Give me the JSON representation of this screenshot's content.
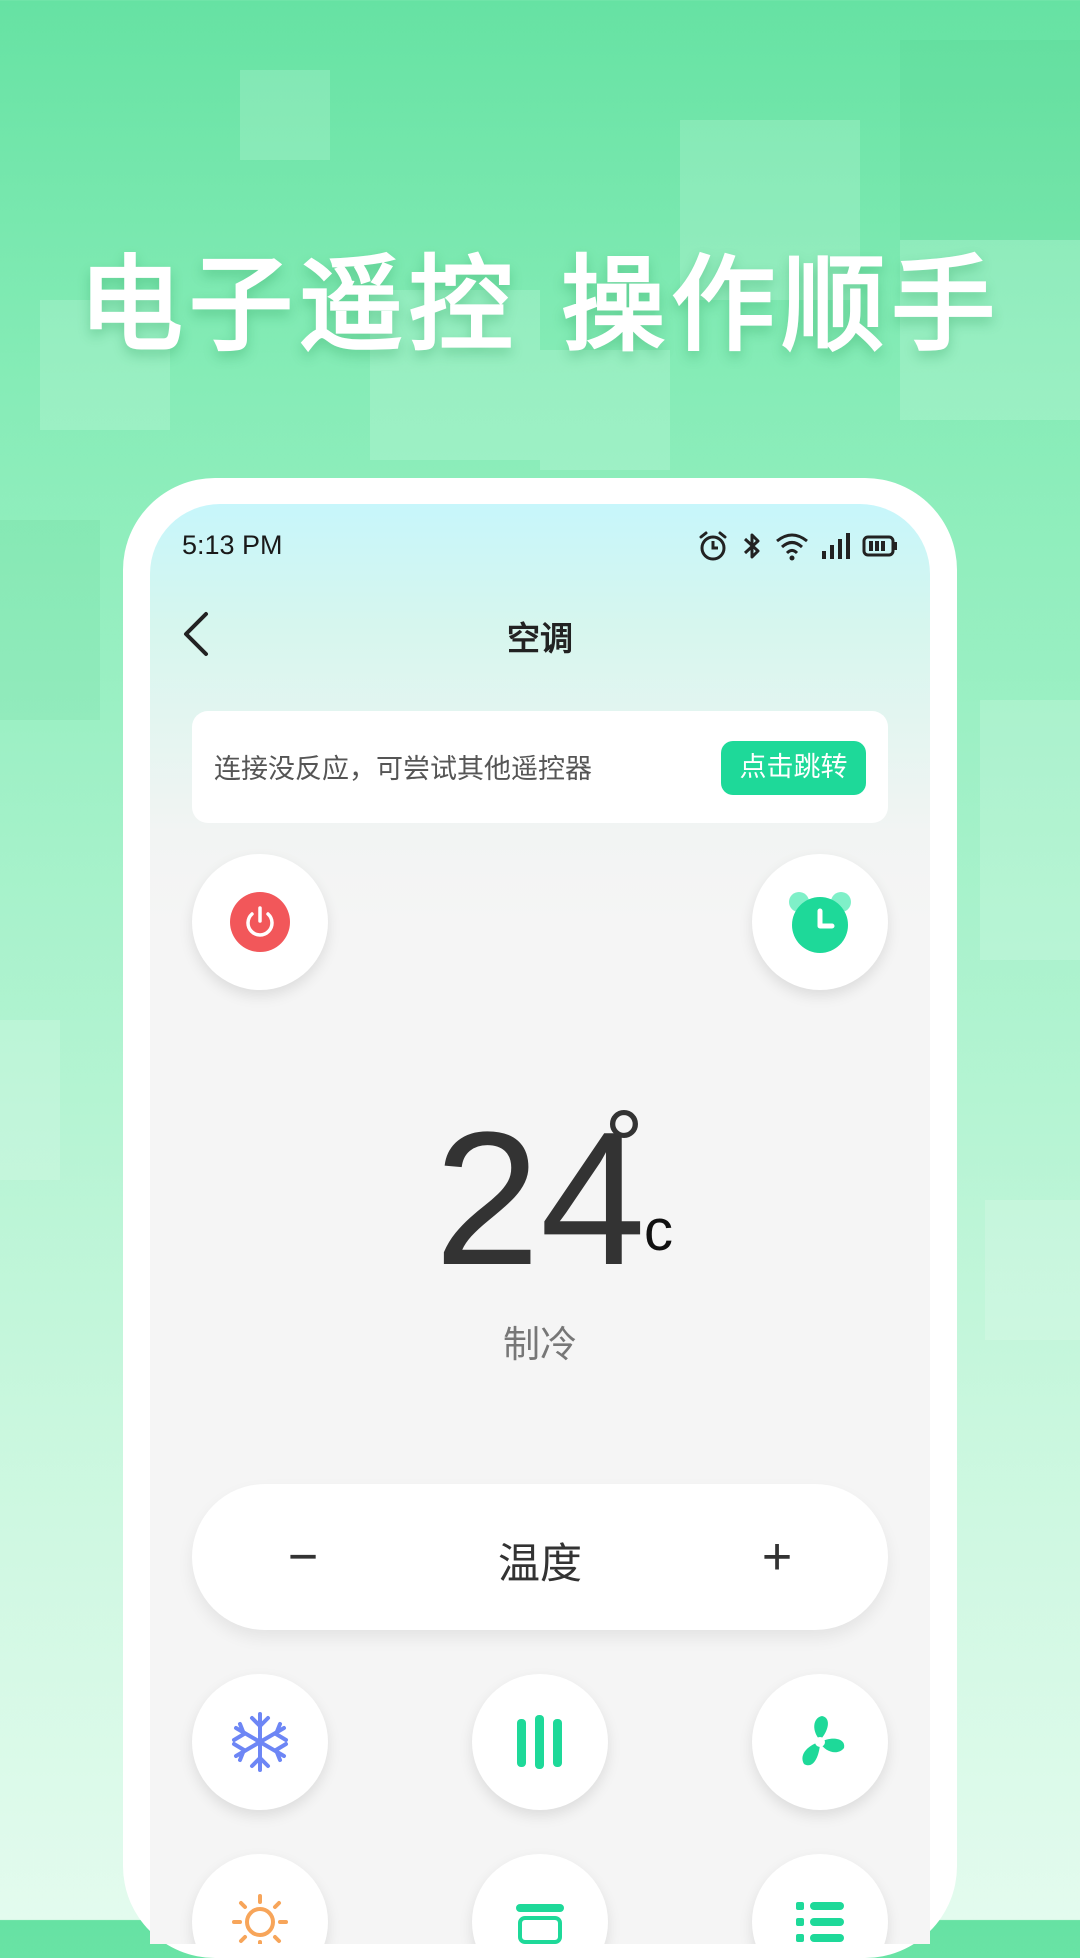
{
  "headline": "电子遥控 操作顺手",
  "status_bar": {
    "time": "5:13 PM",
    "icons": [
      "alarm-icon",
      "bluetooth-icon",
      "wifi-icon",
      "signal-icon",
      "battery-icon"
    ]
  },
  "nav": {
    "back_icon": "chevron-left-icon",
    "title": "空调"
  },
  "tip": {
    "text": "连接没反应，可尝试其他遥控器",
    "button_label": "点击跳转"
  },
  "display": {
    "temperature": "24",
    "degree_symbol": "°",
    "unit": "c",
    "mode": "制冷"
  },
  "temp_control": {
    "minus": "−",
    "label": "温度",
    "plus": "+"
  },
  "colors": {
    "accent": "#1ed999",
    "power": "#f2575a",
    "snow": "#6d86f5",
    "sun": "#f7a55a"
  },
  "buttons": [
    "power-icon",
    "timer-icon",
    "snowflake-icon",
    "swing-icon",
    "fan-icon",
    "sun-icon",
    "mode-icon",
    "list-icon"
  ]
}
